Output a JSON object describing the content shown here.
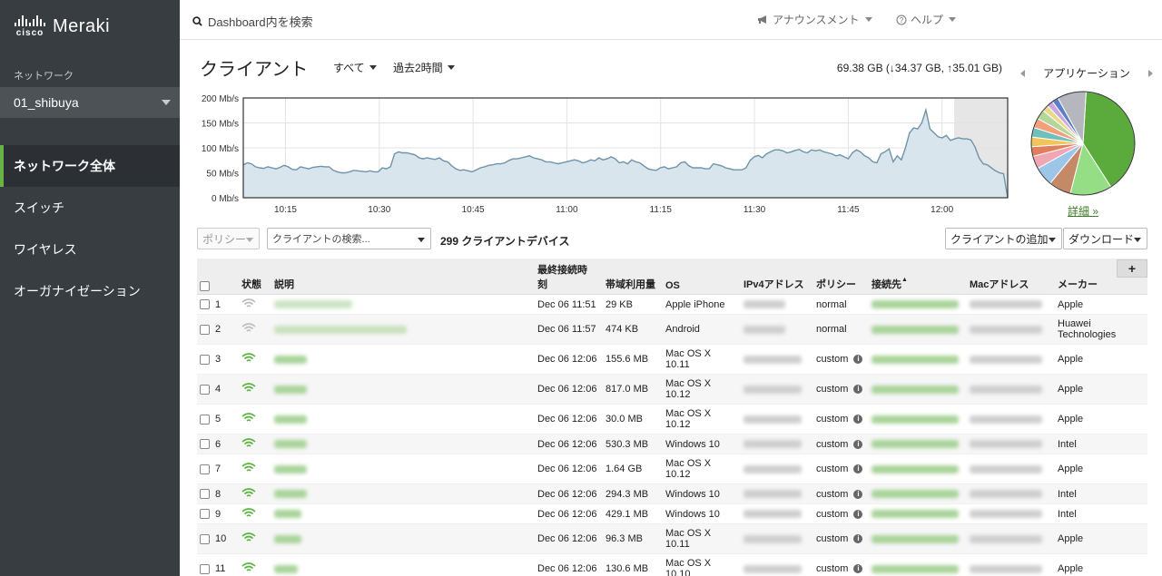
{
  "brand": {
    "cisco": "cisco",
    "product": "Meraki"
  },
  "sidebar": {
    "network_label": "ネットワーク",
    "network_name": "01_shibuya",
    "items": [
      {
        "label": "ネットワーク全体",
        "active": true
      },
      {
        "label": "スイッチ",
        "active": false
      },
      {
        "label": "ワイヤレス",
        "active": false
      },
      {
        "label": "オーガナイゼーション",
        "active": false
      }
    ]
  },
  "topbar": {
    "search_placeholder": "Dashboard内を検索",
    "announcement": "アナウンスメント",
    "help": "ヘルプ"
  },
  "header": {
    "title": "クライアント",
    "filter_all": "すべて",
    "filter_time": "過去2時間",
    "usage": "69.38 GB (↓34.37 GB, ↑35.01 GB)"
  },
  "chart_data": {
    "type": "area",
    "ylabel": "Mb/s",
    "ylim": [
      0,
      200
    ],
    "yticks": [
      "200 Mb/s",
      "150 Mb/s",
      "100 Mb/s",
      "50 Mb/s",
      "0 Mb/s"
    ],
    "xticks": [
      "10:15",
      "10:30",
      "10:45",
      "11:00",
      "11:15",
      "11:30",
      "11:45",
      "12:00"
    ],
    "values": [
      66,
      70,
      68,
      62,
      60,
      59,
      62,
      60,
      58,
      61,
      65,
      62,
      57,
      56,
      62,
      60,
      58,
      61,
      62,
      63,
      62,
      62,
      55,
      52,
      50,
      50,
      52,
      55,
      54,
      53,
      52,
      54,
      52,
      52,
      60,
      58,
      62,
      88,
      92,
      90,
      90,
      88,
      86,
      80,
      78,
      80,
      78,
      77,
      80,
      74,
      72,
      64,
      58,
      55,
      56,
      54,
      52,
      56,
      60,
      62,
      65,
      66,
      68,
      68,
      70,
      75,
      78,
      78,
      80,
      82,
      84,
      80,
      78,
      76,
      72,
      72,
      70,
      68,
      70,
      72,
      74,
      76,
      74,
      70,
      72,
      76,
      74,
      80,
      76,
      78,
      82,
      78,
      70,
      72,
      68,
      76,
      72,
      70,
      64,
      58,
      56,
      55,
      60,
      62,
      58,
      60,
      62,
      70,
      72,
      64,
      60,
      60,
      60,
      58,
      58,
      68,
      66,
      64,
      60,
      58,
      56,
      56,
      56,
      60,
      75,
      82,
      85,
      80,
      88,
      92,
      96,
      96,
      94,
      90,
      92,
      95,
      97,
      92,
      90,
      96,
      94,
      96,
      92,
      90,
      88,
      84,
      86,
      82,
      78,
      90,
      96,
      92,
      84,
      80,
      72,
      70,
      88,
      92,
      98,
      72,
      84,
      76,
      100,
      130,
      140,
      138,
      150,
      176,
      138,
      130,
      122,
      120,
      125,
      115,
      118,
      120,
      118,
      118,
      116,
      102,
      80,
      68,
      66,
      60,
      54,
      50,
      48,
      0
    ],
    "shaded_tail": true
  },
  "apps": {
    "title": "アプリケーション",
    "details_link": "詳細 »",
    "slices": [
      {
        "value": 40,
        "color": "#5aaa3c"
      },
      {
        "value": 13,
        "color": "#96de86"
      },
      {
        "value": 7,
        "color": "#c48a68"
      },
      {
        "value": 6,
        "color": "#9cc6e8"
      },
      {
        "value": 4,
        "color": "#f1a6b4"
      },
      {
        "value": 3,
        "color": "#e07e5e"
      },
      {
        "value": 3,
        "color": "#f2c55a"
      },
      {
        "value": 3,
        "color": "#6fc0bd"
      },
      {
        "value": 3,
        "color": "#f3a07a"
      },
      {
        "value": 3,
        "color": "#b5d69a"
      },
      {
        "value": 2,
        "color": "#e9d98a"
      },
      {
        "value": 2,
        "color": "#c9a8e0"
      },
      {
        "value": 2,
        "color": "#5b7fc8"
      },
      {
        "value": 9,
        "color": "#b6b6be"
      }
    ]
  },
  "toolbar": {
    "policy": "ポリシー",
    "client_search": "クライアントの検索...",
    "client_count": "299 クライアントデバイス",
    "add_client": "クライアントの追加",
    "download": "ダウンロード",
    "add_column": "+"
  },
  "table": {
    "headers": {
      "status": "状態",
      "description": "説明",
      "last_seen_1": "最終接続時",
      "last_seen_2": "刻",
      "usage": "帯域利用量",
      "os": "OS",
      "ipv4": "IPv4アドレス",
      "policy": "ポリシー",
      "connected_to": "接続先",
      "sort_arrow": "▲",
      "mac": "Macアドレス",
      "manufacturer": "メーカー"
    },
    "rows": [
      {
        "num": "1",
        "wifi": "gray",
        "last_seen": "Dec 06 11:51",
        "usage": "29 KB",
        "os": "Apple iPhone",
        "os2": "",
        "policy": "normal",
        "info": false,
        "manufacturer": "Apple",
        "manufacturer2": "",
        "desc_w": 86
      },
      {
        "num": "2",
        "wifi": "gray",
        "last_seen": "Dec 06 11:57",
        "usage": "474 KB",
        "os": "Android",
        "os2": "",
        "policy": "normal",
        "info": false,
        "manufacturer": "Huawei",
        "manufacturer2": "Technologies",
        "desc_w": 146
      },
      {
        "num": "3",
        "wifi": "green",
        "last_seen": "Dec 06 12:06",
        "usage": "155.6 MB",
        "os": "Mac OS X",
        "os2": "10.11",
        "policy": "custom",
        "info": true,
        "manufacturer": "Apple",
        "manufacturer2": "",
        "desc_w": 36
      },
      {
        "num": "4",
        "wifi": "green",
        "last_seen": "Dec 06 12:06",
        "usage": "817.0 MB",
        "os": "Mac OS X",
        "os2": "10.12",
        "policy": "custom",
        "info": true,
        "manufacturer": "Apple",
        "manufacturer2": "",
        "desc_w": 36
      },
      {
        "num": "5",
        "wifi": "green",
        "last_seen": "Dec 06 12:06",
        "usage": "30.0 MB",
        "os": "Mac OS X",
        "os2": "10.12",
        "policy": "custom",
        "info": true,
        "manufacturer": "Apple",
        "manufacturer2": "",
        "desc_w": 36
      },
      {
        "num": "6",
        "wifi": "green",
        "last_seen": "Dec 06 12:06",
        "usage": "530.3 MB",
        "os": "Windows 10",
        "os2": "",
        "policy": "custom",
        "info": true,
        "manufacturer": "Intel",
        "manufacturer2": "",
        "desc_w": 36
      },
      {
        "num": "7",
        "wifi": "green",
        "last_seen": "Dec 06 12:06",
        "usage": "1.64 GB",
        "os": "Mac OS X",
        "os2": "10.12",
        "policy": "custom",
        "info": true,
        "manufacturer": "Apple",
        "manufacturer2": "",
        "desc_w": 36
      },
      {
        "num": "8",
        "wifi": "green",
        "last_seen": "Dec 06 12:06",
        "usage": "294.3 MB",
        "os": "Windows 10",
        "os2": "",
        "policy": "custom",
        "info": true,
        "manufacturer": "Intel",
        "manufacturer2": "",
        "desc_w": 36
      },
      {
        "num": "9",
        "wifi": "green",
        "last_seen": "Dec 06 12:06",
        "usage": "429.1 MB",
        "os": "Windows 10",
        "os2": "",
        "policy": "custom",
        "info": true,
        "manufacturer": "Intel",
        "manufacturer2": "",
        "desc_w": 30
      },
      {
        "num": "10",
        "wifi": "green",
        "last_seen": "Dec 06 12:06",
        "usage": "96.3 MB",
        "os": "Mac OS X",
        "os2": "10.11",
        "policy": "custom",
        "info": true,
        "manufacturer": "Apple",
        "manufacturer2": "",
        "desc_w": 30
      },
      {
        "num": "11",
        "wifi": "green",
        "last_seen": "Dec 06 12:06",
        "usage": "130.6 MB",
        "os": "Mac OS X",
        "os2": "10.10",
        "policy": "custom",
        "info": true,
        "manufacturer": "Apple",
        "manufacturer2": "",
        "desc_w": 26
      }
    ]
  }
}
